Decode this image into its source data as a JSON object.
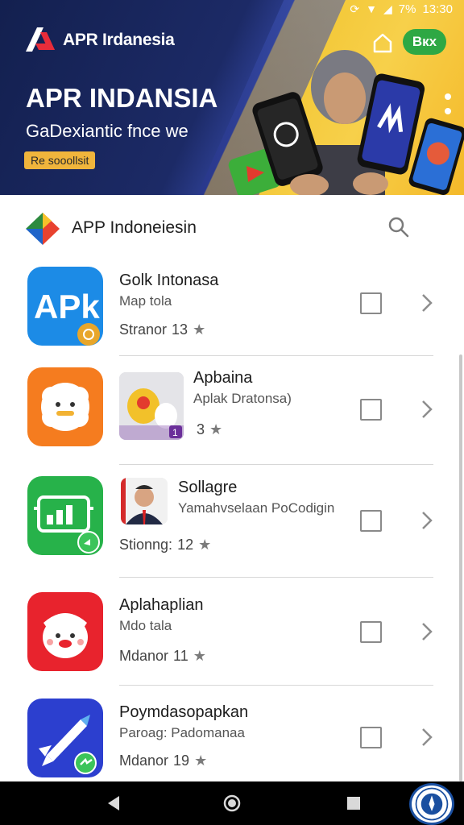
{
  "status_bar": {
    "battery": "7%",
    "time": "13:30"
  },
  "banner": {
    "brand_name": "APR Irdanesia",
    "action_label": "Bкx",
    "hero_title": "APR INDANSIA",
    "hero_subtitle": "GaDexiantic fnce we",
    "hero_badge": "Re sooollsit"
  },
  "header": {
    "title": "APP Indoneiesin"
  },
  "apps": [
    {
      "title": "Golk Intonasa",
      "subtitle": "Map tola",
      "rating_label": "Stranor",
      "rating": "13",
      "icon": "apk-icon",
      "icon_color": "#1c8be6"
    },
    {
      "title": "Apbaina",
      "subtitle": "Aplak Dratonsa)",
      "rating_label": "",
      "rating": "3",
      "icon": "flower-face-icon",
      "icon_color": "#f57c1f",
      "thumb_badge": "1"
    },
    {
      "title": "Sollagre",
      "subtitle": "Yamahvselaan PoCodigin",
      "rating_label": "Stionng:",
      "rating": "12",
      "icon": "chart-board-icon",
      "icon_color": "#27b24a"
    },
    {
      "title": "Aplahaplian",
      "subtitle": "Mdo tala",
      "rating_label": "Mdanor",
      "rating": "11",
      "icon": "mascot-face-icon",
      "icon_color": "#e8232d"
    },
    {
      "title": "Poymdasopapkan",
      "subtitle": "Paroag: Padomanaa",
      "rating_label": "Mdanor",
      "rating": "19",
      "icon": "rocket-pen-icon",
      "icon_color": "#2c3fcf"
    }
  ],
  "nav": {
    "back": "back-icon",
    "home": "home-circle-icon",
    "recents": "recents-square-icon"
  }
}
